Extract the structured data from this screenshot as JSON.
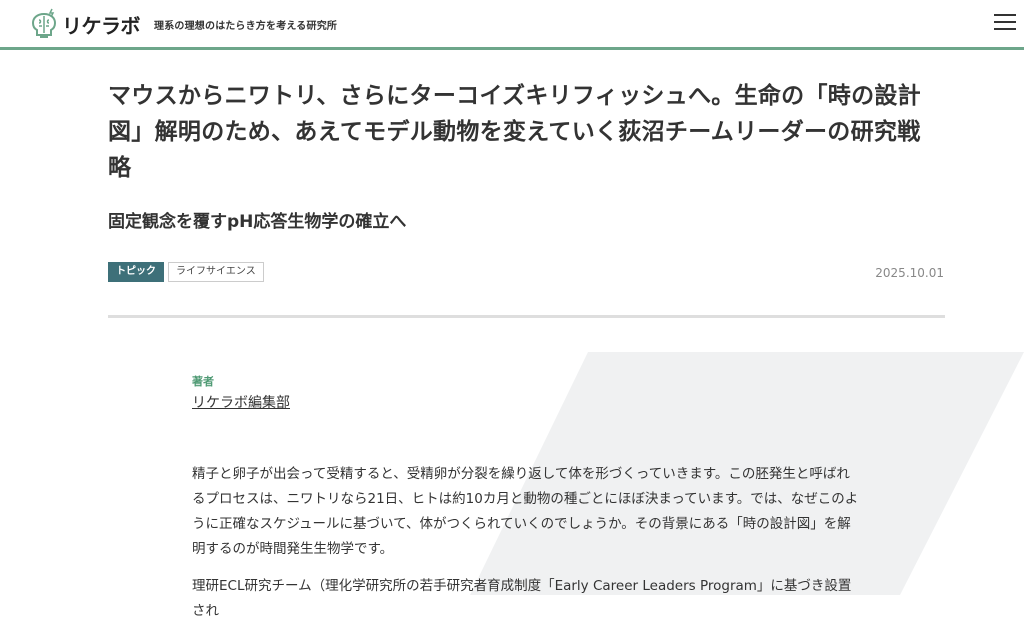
{
  "header": {
    "logo_text": "リケラボ",
    "tagline": "理系の理想のはたらき方を考える研究所"
  },
  "article": {
    "title": "マウスからニワトリ、さらにターコイズキリフィッシュへ。生命の「時の設計図」解明のため、あえてモデル動物を変えていく荻沼チームリーダーの研究戦略",
    "subtitle": "固定観念を覆すpH応答生物学の確立へ",
    "tags": [
      {
        "label": "トピック"
      },
      {
        "label": "ライフサイエンス"
      }
    ],
    "date": "2025.10.01",
    "author_label": "著者",
    "author_name": "リケラボ編集部",
    "paragraphs": [
      "精子と卵子が出会って受精すると、受精卵が分裂を繰り返して体を形づくっていきます。この胚発生と呼ばれるプロセスは、ニワトリなら21日、ヒトは約10カ月と動物の種ごとにほぼ決まっています。では、なぜこのように正確なスケジュールに基づいて、体がつくられていくのでしょうか。その背景にある「時の設計図」を解明するのが時間発生生物学です。",
      "理研ECL研究チーム（理化学研究所の若手研究者育成制度「Early Career Leaders Program」に基づき設置され"
    ]
  },
  "colors": {
    "accent_line": "#6da68a",
    "tag_primary_bg": "#3e7079",
    "author_label": "#4f9a74",
    "deco_shape": "#f0f1f2"
  },
  "icons": {
    "logo": "brain-bulb-icon",
    "menu": "hamburger-menu-icon"
  }
}
